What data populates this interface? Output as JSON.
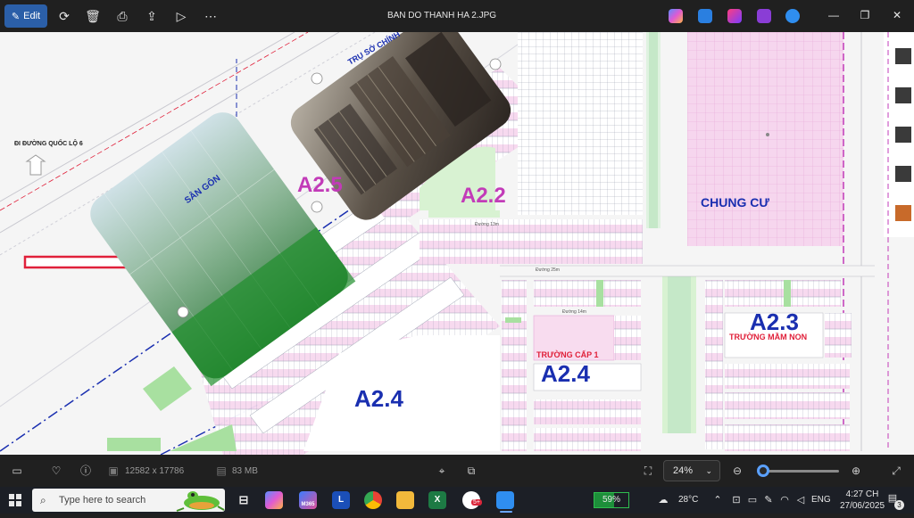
{
  "toolbar": {
    "edit_label": "Edit",
    "file_title": "BAN DO THANH HA 2.JPG",
    "icons": [
      "rotate-icon",
      "delete-icon",
      "print-icon",
      "share-icon",
      "slideshow-icon",
      "more-icon"
    ]
  },
  "map": {
    "labels": {
      "a25": "A2.5",
      "a22": "A2.2",
      "a24_left": "A2.4",
      "a24_center": "A2.4",
      "a23": "A2.3",
      "chung_cu": "CHUNG CƯ",
      "truong_mam_non": "TRƯỜNG MẦM NON",
      "truong_cap1": "TRƯỜNG CẤP 1",
      "san_gon": "SÂN GÔN",
      "tru_so": "TRỤ SỞ CHÍNH",
      "di_duong": "ĐI ĐƯỜNG QUỐC LỘ 6",
      "street_25": "Đường 25m",
      "street_14": "Đường 14m",
      "street_13": "Đường 13m"
    },
    "colors": {
      "zone_label_magenta": "#c23bb8",
      "zone_label_blue": "#1a2fb0",
      "school_red": "#e0203a",
      "arrow_red": "#e0203a",
      "plot_pink": "#f3c8e8",
      "green_area": "#d8f2d2"
    }
  },
  "infobar": {
    "dimensions": "12582 x 17786",
    "file_size": "83 MB",
    "zoom_value": "24%",
    "zoom_fraction": 0.05
  },
  "taskbar": {
    "search_placeholder": "Type here to search",
    "battery_percent": "59%",
    "battery_fraction": 0.59,
    "weather": "28°C",
    "language": "ENG",
    "time": "4:27 CH",
    "date": "27/06/2025",
    "notification_count": "3",
    "chrome_badge": "5+",
    "m365_label": "M365"
  }
}
